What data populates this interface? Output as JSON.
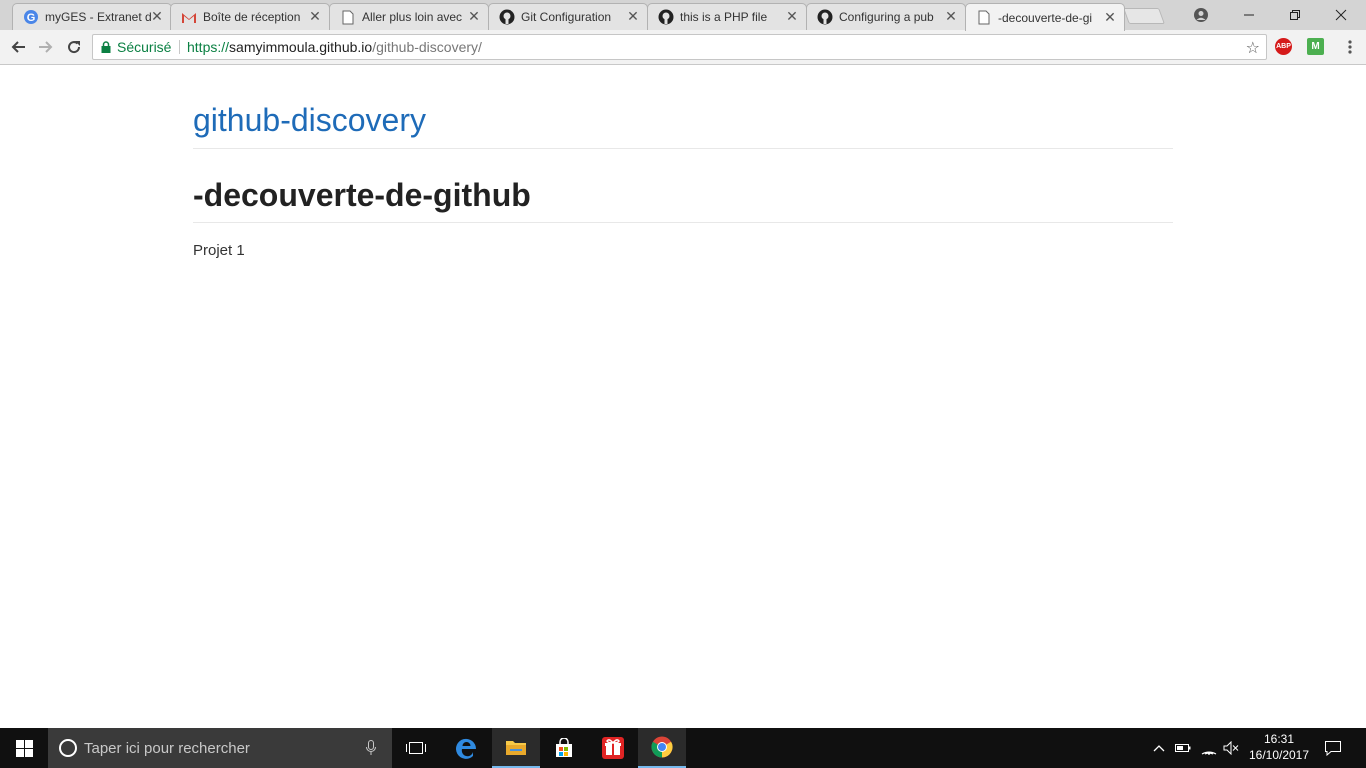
{
  "browser": {
    "tabs": [
      {
        "title": "myGES - Extranet de",
        "icon": "g-logo-icon"
      },
      {
        "title": "Boîte de réception",
        "icon": "gmail-icon"
      },
      {
        "title": "Aller plus loin avec",
        "icon": "page-icon"
      },
      {
        "title": "Git Configuration",
        "icon": "github-icon"
      },
      {
        "title": "this is a PHP file",
        "icon": "github-icon"
      },
      {
        "title": "Configuring a pub",
        "icon": "github-icon"
      },
      {
        "title": "-decouverte-de-gi",
        "icon": "page-icon",
        "active": true
      }
    ],
    "secure_label": "Sécurisé",
    "url": {
      "scheme": "https://",
      "host": "samyimmoula.github.io",
      "path": "/github-discovery/"
    },
    "extensions": {
      "abp_label": "ABP",
      "second_ext_label": "M"
    }
  },
  "page": {
    "repo_title": "github-discovery",
    "heading": "-decouverte-de-github",
    "body": "Projet 1"
  },
  "taskbar": {
    "search_placeholder": "Taper ici pour rechercher",
    "time": "16:31",
    "date": "16/10/2017"
  },
  "colors": {
    "link": "#1e6bb8",
    "secure": "#0b8043",
    "taskbar": "#101010"
  }
}
